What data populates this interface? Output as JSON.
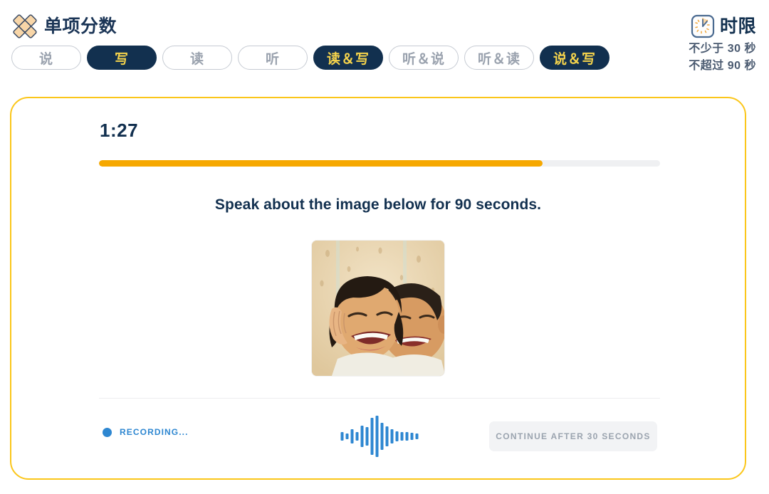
{
  "header": {
    "brand_title": "单项分数",
    "logo_icon": "diamond-lattice-logo",
    "tabs": [
      {
        "label": "说",
        "active": false
      },
      {
        "label": "写",
        "active": true
      },
      {
        "label": "读",
        "active": false
      },
      {
        "label": "听",
        "active": false
      },
      {
        "label": "读＆写",
        "active": true
      },
      {
        "label": "听＆说",
        "active": false
      },
      {
        "label": "听＆读",
        "active": false
      },
      {
        "label": "说＆写",
        "active": true
      }
    ],
    "limit": {
      "icon": "clock-icon",
      "title": "时限",
      "min_line": "不少于 30 秒",
      "max_line": "不超过 90 秒"
    }
  },
  "card": {
    "timer": "1:27",
    "progress_percent": 79,
    "prompt": "Speak about the image below for 90 seconds.",
    "image_alt": "two laughing children cheek to cheek",
    "footer": {
      "recording_label": "RECORDING...",
      "recording_color": "#2E87D1",
      "waveform_heights": [
        12,
        8,
        20,
        12,
        30,
        26,
        52,
        58,
        38,
        28,
        20,
        14,
        12,
        12,
        10,
        8
      ],
      "continue_label": "CONTINUE AFTER 30 SECONDS"
    }
  },
  "colors": {
    "navy": "#12304F",
    "gold": "#F6D44C",
    "orange": "#F6A800",
    "card_border": "#FBC61A",
    "blue": "#2E87D1",
    "muted": "#9AA2AE"
  }
}
